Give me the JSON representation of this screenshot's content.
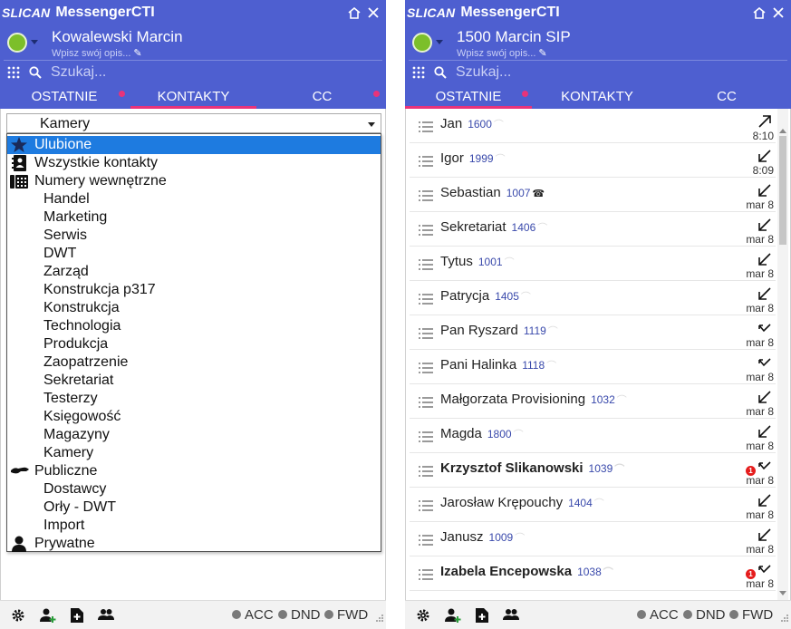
{
  "colors": {
    "header": "#4e5fd0",
    "accent": "#e8337a",
    "status_ok": "#7cbf2a",
    "selected": "#1e7be0",
    "number": "#3949ab",
    "badge": "#e51c1c"
  },
  "left": {
    "brand": "SLICAN",
    "app_title": "MessengerCTI",
    "user_name": "Kowalewski Marcin",
    "user_desc": "Wpisz swój opis...",
    "search_placeholder": "Szukaj...",
    "tabs": [
      {
        "label": "OSTATNIE",
        "active": false,
        "dot": true
      },
      {
        "label": "KONTAKTY",
        "active": true,
        "dot": false
      },
      {
        "label": "CC",
        "active": false,
        "dot": true
      }
    ],
    "select_value": "Kamery",
    "options": [
      {
        "label": "Ulubione",
        "icon": "star-icon",
        "level": "group",
        "selected": true
      },
      {
        "label": "Wszystkie kontakty",
        "icon": "address-book-icon",
        "level": "group"
      },
      {
        "label": "Numery wewnętrzne",
        "icon": "phone-book-icon",
        "level": "group"
      },
      {
        "label": "Handel",
        "level": "child"
      },
      {
        "label": "Marketing",
        "level": "child"
      },
      {
        "label": "Serwis",
        "level": "child"
      },
      {
        "label": "DWT",
        "level": "child"
      },
      {
        "label": "Zarząd",
        "level": "child"
      },
      {
        "label": "Konstrukcja p317",
        "level": "child"
      },
      {
        "label": "Konstrukcja",
        "level": "child"
      },
      {
        "label": "Technologia",
        "level": "child"
      },
      {
        "label": "Produkcja",
        "level": "child"
      },
      {
        "label": "Zaopatrzenie",
        "level": "child"
      },
      {
        "label": "Sekretariat",
        "level": "child"
      },
      {
        "label": "Testerzy",
        "level": "child"
      },
      {
        "label": "Księgowość",
        "level": "child"
      },
      {
        "label": "Magazyny",
        "level": "child"
      },
      {
        "label": "Kamery",
        "level": "child"
      },
      {
        "label": "Publiczne",
        "icon": "handshake-icon",
        "level": "group"
      },
      {
        "label": "Dostawcy",
        "level": "child"
      },
      {
        "label": "Orły - DWT",
        "level": "child"
      },
      {
        "label": "Import",
        "level": "child"
      },
      {
        "label": "Prywatne",
        "icon": "person-icon",
        "level": "group"
      }
    ],
    "footer": {
      "acc": "ACC",
      "dnd": "DND",
      "fwd": "FWD"
    }
  },
  "right": {
    "brand": "SLICAN",
    "app_title": "MessengerCTI",
    "user_name": "1500 Marcin SIP",
    "user_desc": "Wpisz swój opis...",
    "search_placeholder": "Szukaj...",
    "tabs": [
      {
        "label": "OSTATNIE",
        "active": true,
        "dot": true
      },
      {
        "label": "KONTAKTY",
        "active": false,
        "dot": false
      },
      {
        "label": "CC",
        "active": false,
        "dot": false
      }
    ],
    "recent": [
      {
        "name": "Jan",
        "number": "1600",
        "direction": "outgoing",
        "time": "8:10",
        "bold": false,
        "missed": false
      },
      {
        "name": "Igor",
        "number": "1999",
        "direction": "incoming",
        "time": "8:09",
        "bold": false,
        "missed": false
      },
      {
        "name": "Sebastian",
        "number": "1007",
        "direction": "incoming",
        "time": "mar 8",
        "bold": false,
        "missed": false,
        "handset_dark": true
      },
      {
        "name": "Sekretariat",
        "number": "1406",
        "direction": "incoming",
        "time": "mar 8",
        "bold": false,
        "missed": false
      },
      {
        "name": "Tytus",
        "number": "1001",
        "direction": "incoming",
        "time": "mar 8",
        "bold": false,
        "missed": false
      },
      {
        "name": "Patrycja",
        "number": "1405",
        "direction": "incoming",
        "time": "mar 8",
        "bold": false,
        "missed": false
      },
      {
        "name": "Pan Ryszard",
        "number": "1119",
        "direction": "missed",
        "time": "mar 8",
        "bold": false,
        "missed": false
      },
      {
        "name": "Pani Halinka",
        "number": "1118",
        "direction": "missed",
        "time": "mar 8",
        "bold": false,
        "missed": false
      },
      {
        "name": "Małgorzata Provisioning",
        "number": "1032",
        "direction": "incoming",
        "time": "mar 8",
        "bold": false,
        "missed": false
      },
      {
        "name": "Magda",
        "number": "1800",
        "direction": "incoming",
        "time": "mar 8",
        "bold": false,
        "missed": false
      },
      {
        "name": "Krzysztof Slikanowski",
        "number": "1039",
        "direction": "missed",
        "time": "mar 8",
        "bold": true,
        "missed": true,
        "badge": "1"
      },
      {
        "name": "Jarosław Krępouchy",
        "number": "1404",
        "direction": "incoming",
        "time": "mar 8",
        "bold": false,
        "missed": false
      },
      {
        "name": "Janusz",
        "number": "1009",
        "direction": "incoming",
        "time": "mar 8",
        "bold": false,
        "missed": false
      },
      {
        "name": "Izabela Encepowska",
        "number": "1038",
        "direction": "missed",
        "time": "mar 8",
        "bold": true,
        "missed": true,
        "badge": "1"
      }
    ],
    "footer": {
      "acc": "ACC",
      "dnd": "DND",
      "fwd": "FWD"
    }
  }
}
